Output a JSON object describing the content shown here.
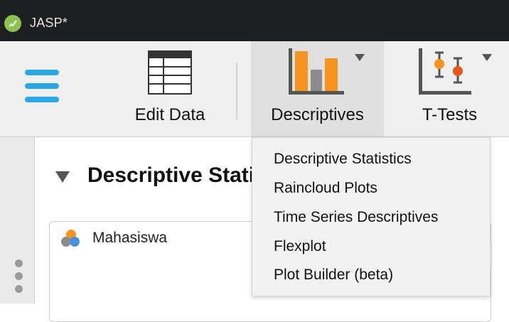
{
  "window": {
    "title": "JASP*"
  },
  "ribbon": {
    "edit_data_label": "Edit Data",
    "descriptives_label": "Descriptives",
    "ttests_label": "T-Tests"
  },
  "dropdown": {
    "items": [
      "Descriptive Statistics",
      "Raincloud Plots",
      "Time Series Descriptives",
      "Flexplot",
      "Plot Builder (beta)"
    ]
  },
  "analysis": {
    "title": "Descriptive Statistics",
    "variables": [
      "Mahasiswa"
    ]
  },
  "colors": {
    "accent": "#2aa8e6",
    "bar_orange": "#f7941d",
    "bar_gray": "#8c8c8c"
  }
}
